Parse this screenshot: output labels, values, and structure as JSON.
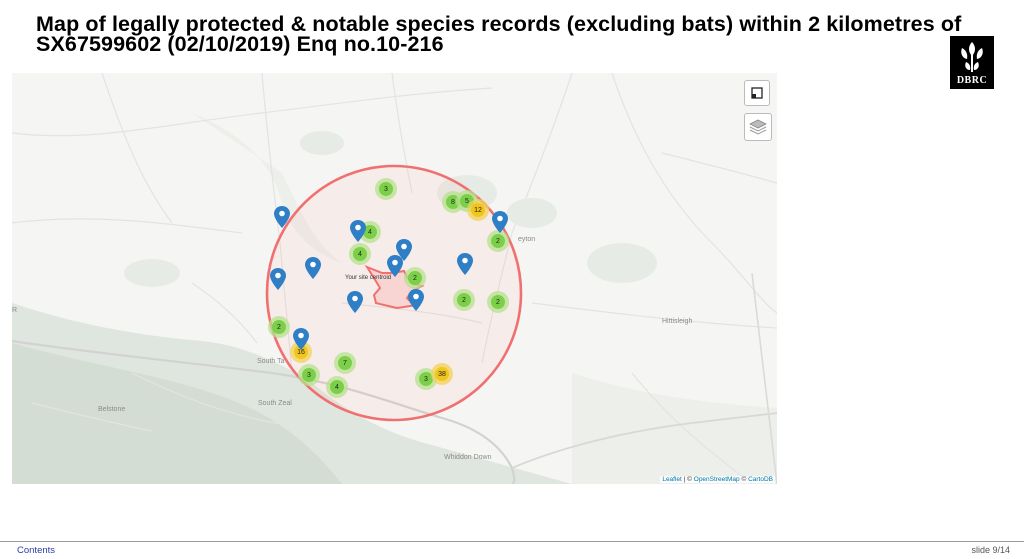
{
  "title": "Map of legally protected & notable species records (excluding bats) within 2 kilometres of SX67599602 (02/10/2019) Enq no.10-216",
  "logo": {
    "text": "DBRC",
    "icon": "leaf-tree-logo"
  },
  "map": {
    "site_label": "Your site centroid",
    "places": {
      "south_tawton": "South Ta",
      "south_zeal": "South Zeal",
      "belstone": "Belstone",
      "hittisleigh": "Hittisleigh",
      "whiddon_down": "Whiddon Down",
      "yeton": "eyton",
      "r_edge": "R"
    },
    "clusters": [
      {
        "count": "3",
        "level": "green"
      },
      {
        "count": "8",
        "level": "green"
      },
      {
        "count": "5",
        "level": "green"
      },
      {
        "count": "12",
        "level": "yellow"
      },
      {
        "count": "4",
        "level": "green"
      },
      {
        "count": "4",
        "level": "green"
      },
      {
        "count": "2",
        "level": "green"
      },
      {
        "count": "2",
        "level": "green"
      },
      {
        "count": "2",
        "level": "green"
      },
      {
        "count": "2",
        "level": "green"
      },
      {
        "count": "2",
        "level": "green"
      },
      {
        "count": "16",
        "level": "yellow"
      },
      {
        "count": "7",
        "level": "green"
      },
      {
        "count": "3",
        "level": "green"
      },
      {
        "count": "4",
        "level": "green"
      },
      {
        "count": "3",
        "level": "green"
      },
      {
        "count": "38",
        "level": "yellow"
      }
    ],
    "marker_icon": "map-pin-icon",
    "controls": {
      "fullscreen_icon": "fullscreen-icon",
      "layers_icon": "layers-icon"
    },
    "attribution": {
      "leaflet": "Leaflet",
      "sep": " | © ",
      "osm": "OpenStreetMap",
      "sep2": " © ",
      "carto": "CartoDB"
    },
    "colors": {
      "buffer_circle": "#f07070",
      "site_boundary": "#f07070",
      "marker": "#2f7fc7",
      "cluster_green": "#6ecc39",
      "cluster_yellow": "#f0c20c"
    }
  },
  "footer": {
    "contents_link": "Contents",
    "slide_indicator": "slide 9/14"
  }
}
